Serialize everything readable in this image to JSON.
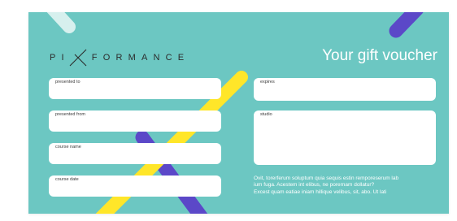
{
  "brand": {
    "logo_before": "PI",
    "logo_after": "FORMANCE",
    "logo_mark_icon": "x-cross-icon"
  },
  "title": "Your gift voucher",
  "fields": {
    "presented_to": "presented to",
    "presented_from": "presented from",
    "course_name": "course name",
    "course_date": "course date",
    "expires": "expires",
    "studio": "studio"
  },
  "fine_print": {
    "line1": "Ovit, torerferum soluptum quia sequis estin remporeserum lab",
    "line2": "ium fuga. Acestem int elibus, ne porernam dollatur?",
    "line3": "Excest quam eatiae iniam hillique velibus, sit, abo. Ut lati"
  },
  "colors": {
    "background": "#6cc7c2",
    "field": "#ffffff",
    "stripe_yellow": "#ffe629",
    "stripe_purple": "#5b48c8",
    "stripe_light": "#d7f0ee"
  }
}
